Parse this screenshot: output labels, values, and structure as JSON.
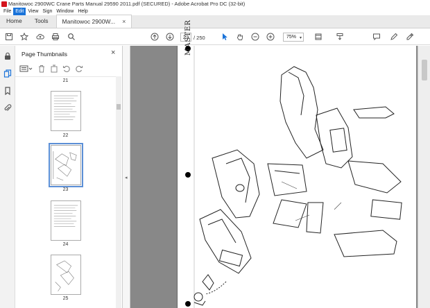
{
  "window": {
    "title": "Manitowoc 2900WC Crane Parts Manual 29590 2011.pdf (SECURED) - Adobe Acrobat Pro DC (32-bit)"
  },
  "menu": {
    "items": [
      "File",
      "Edit",
      "View",
      "Sign",
      "Window",
      "Help"
    ],
    "active_index": 1
  },
  "tabs": {
    "home": "Home",
    "tools": "Tools",
    "document": "Manitowoc 2900W...",
    "close": "×"
  },
  "toolbar": {
    "page_current": "23",
    "page_total": "/ 250",
    "zoom": "75%"
  },
  "thumbnails_panel": {
    "title": "Page Thumbnails",
    "close": "×",
    "pages": [
      {
        "label": "21",
        "selected": false
      },
      {
        "label": "22",
        "selected": false
      },
      {
        "label": "23",
        "selected": true
      },
      {
        "label": "24",
        "selected": false
      },
      {
        "label": "25",
        "selected": false
      }
    ]
  },
  "document": {
    "stamp_text": "MASTER"
  },
  "icons": {
    "rail": [
      "lock-icon",
      "pages-icon",
      "bookmark-icon",
      "attachment-icon"
    ],
    "accent": "#1a73d9"
  }
}
